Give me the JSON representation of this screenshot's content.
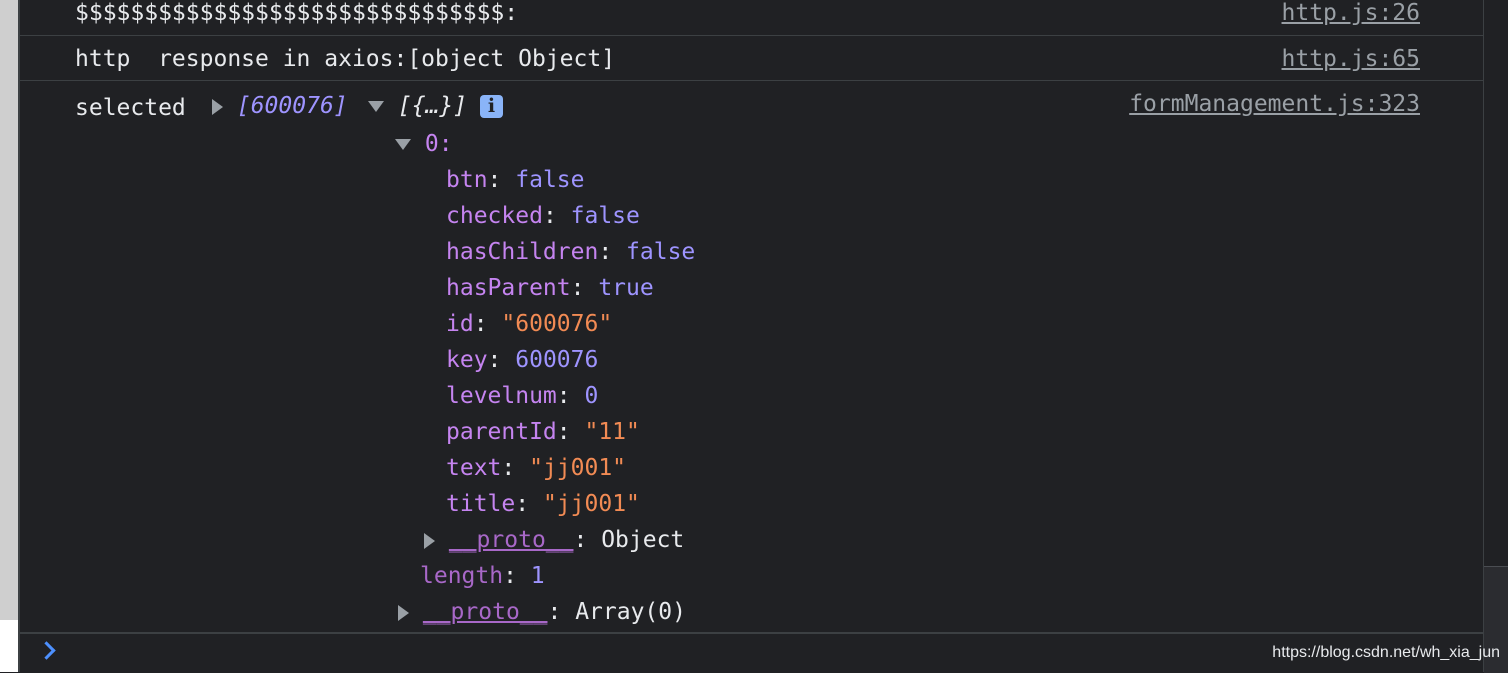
{
  "console": {
    "messages": [
      {
        "text": "$$$$$$$$$$$$$$$$$$$$$$$$$$$$$$$:",
        "source": "http.js:26"
      },
      {
        "text": "http  response in axios:[object Object]",
        "source": "http.js:65"
      },
      {
        "label": "selected",
        "preview_array": "[600076]",
        "preview_objects": "[{…}]",
        "info_icon": "i",
        "source": "formManagement.js:323",
        "item_index": "0:",
        "properties": [
          {
            "key": "btn",
            "value": "false",
            "type": "bool"
          },
          {
            "key": "checked",
            "value": "false",
            "type": "bool"
          },
          {
            "key": "hasChildren",
            "value": "false",
            "type": "bool"
          },
          {
            "key": "hasParent",
            "value": "true",
            "type": "bool"
          },
          {
            "key": "id",
            "value": "\"600076\"",
            "type": "string"
          },
          {
            "key": "key",
            "value": "600076",
            "type": "number"
          },
          {
            "key": "levelnum",
            "value": "0",
            "type": "number"
          },
          {
            "key": "parentId",
            "value": "\"11\"",
            "type": "string"
          },
          {
            "key": "text",
            "value": "\"jj001\"",
            "type": "string"
          },
          {
            "key": "title",
            "value": "\"jj001\"",
            "type": "string"
          }
        ],
        "item_proto": {
          "key": "__proto__",
          "value": "Object"
        },
        "length": {
          "key": "length",
          "value": "1"
        },
        "array_proto": {
          "key": "__proto__",
          "value": "Array(0)"
        }
      }
    ],
    "prompt_value": ""
  },
  "watermark": "https://blog.csdn.net/wh_xia_jun"
}
